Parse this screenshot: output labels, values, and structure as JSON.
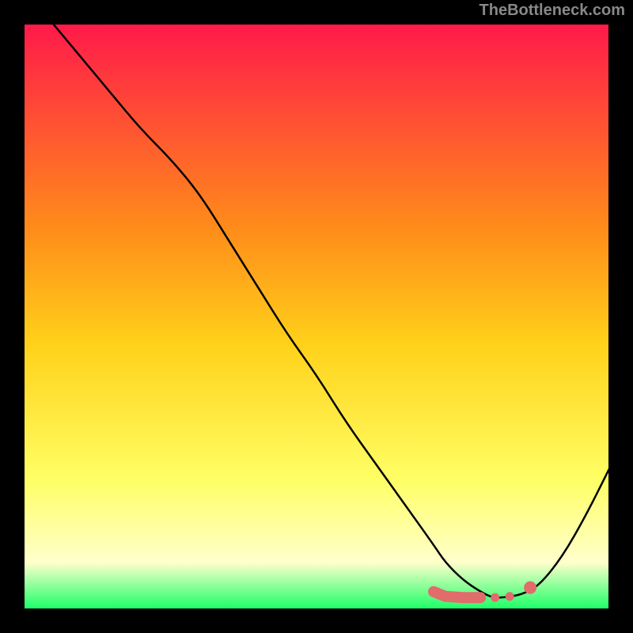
{
  "watermark": "TheBottleneck.com",
  "colors": {
    "gradient_top": "#ff1a4a",
    "gradient_mid_upper": "#ff8c1a",
    "gradient_mid": "#ffd21a",
    "gradient_mid_lower": "#ffff66",
    "gradient_low": "#ffffcc",
    "gradient_bottom": "#1aff66",
    "curve": "#000000",
    "marker": "#e26b6b",
    "frame": "#000000"
  },
  "chart_data": {
    "type": "line",
    "title": "",
    "xlabel": "",
    "ylabel": "",
    "xlim": [
      0,
      100
    ],
    "ylim": [
      0,
      100
    ],
    "series": [
      {
        "name": "bottleneck-curve",
        "x": [
          5,
          10,
          15,
          20,
          25,
          30,
          35,
          40,
          45,
          50,
          55,
          60,
          65,
          70,
          72,
          75,
          78,
          80,
          82,
          85,
          88,
          92,
          96,
          100
        ],
        "values": [
          100,
          94,
          88,
          82,
          77,
          71,
          63,
          55,
          47,
          40,
          32,
          25,
          18,
          11,
          8,
          5,
          3,
          2,
          2,
          2.5,
          4,
          9,
          16,
          24
        ]
      }
    ],
    "markers": [
      {
        "name": "highlight-segment-start",
        "x": 70,
        "y": 3,
        "shape": "round"
      },
      {
        "name": "highlight-segment-a",
        "x": 72,
        "y": 2.2,
        "shape": "round"
      },
      {
        "name": "highlight-segment-b",
        "x": 75,
        "y": 2,
        "shape": "round"
      },
      {
        "name": "highlight-segment-c",
        "x": 78,
        "y": 2,
        "shape": "round"
      },
      {
        "name": "highlight-dot-1",
        "x": 80.5,
        "y": 2,
        "shape": "dot"
      },
      {
        "name": "highlight-dot-2",
        "x": 83,
        "y": 2.2,
        "shape": "dot"
      },
      {
        "name": "highlight-dot-3",
        "x": 86.5,
        "y": 3.7,
        "shape": "dot-large"
      }
    ]
  }
}
